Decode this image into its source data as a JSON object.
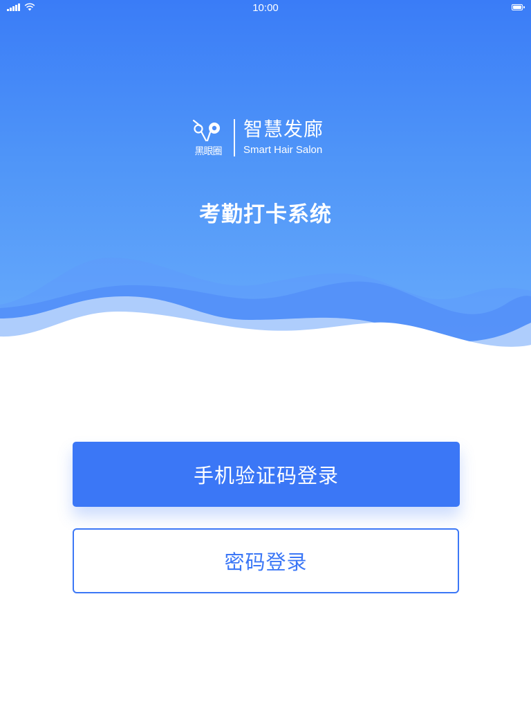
{
  "status_bar": {
    "time": "10:00",
    "signal_icon": "cellular-signal-icon",
    "wifi_icon": "wifi-icon",
    "battery_icon": "battery-icon"
  },
  "brand": {
    "logo_icon": "scissors-comb-logo-icon",
    "logo_text": "黑眼圈",
    "name_cn": "智慧发廊",
    "name_en": "Smart Hair Salon"
  },
  "system_title": "考勤打卡系统",
  "buttons": {
    "sms_login": "手机验证码登录",
    "password_login": "密码登录"
  },
  "colors": {
    "primary": "#3b77f6",
    "hero_top": "#3a7cf7",
    "hero_bottom": "#69acfb",
    "text_on_primary": "#ffffff"
  }
}
